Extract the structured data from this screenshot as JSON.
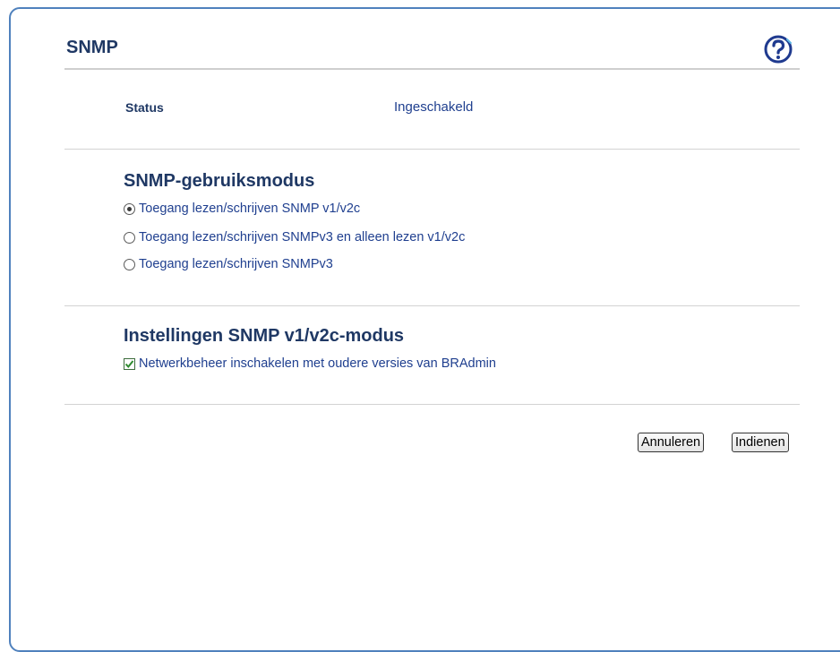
{
  "page": {
    "title": "SNMP",
    "help_icon": "question-mark-help-icon"
  },
  "status": {
    "label": "Status",
    "value": "Ingeschakeld"
  },
  "usage_mode": {
    "heading": "SNMP-gebruiksmodus",
    "options": [
      {
        "label": "Toegang lezen/schrijven SNMP v1/v2c",
        "selected": true
      },
      {
        "label": "Toegang lezen/schrijven SNMPv3 en alleen lezen v1/v2c",
        "selected": false
      },
      {
        "label": "Toegang lezen/schrijven SNMPv3",
        "selected": false
      }
    ]
  },
  "v1v2c_settings": {
    "heading": "Instellingen SNMP v1/v2c-modus",
    "checkbox_label": "Netwerkbeheer inschakelen met oudere versies van BRAdmin",
    "checked": true
  },
  "buttons": {
    "cancel_label": "Annuleren",
    "submit_label": "Indienen"
  },
  "colors": {
    "heading": "#1f3864",
    "text": "#1f3f8f",
    "frame_border": "#4f81bd"
  }
}
